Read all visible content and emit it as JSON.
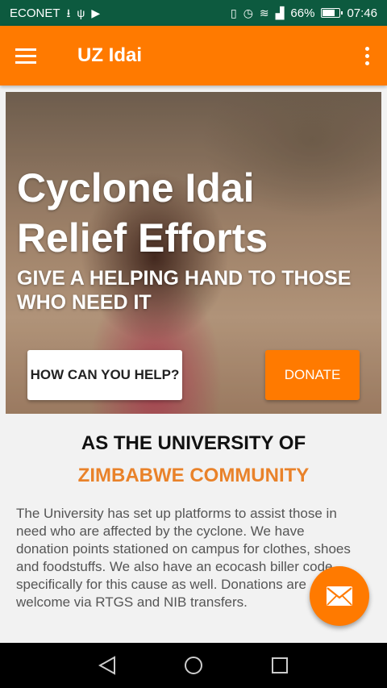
{
  "status_bar": {
    "carrier": "ECONET",
    "battery_percent": "66%",
    "battery_level": 0.66,
    "time": "07:46",
    "left_icons": [
      "download-icon",
      "usb-icon",
      "media-icon"
    ],
    "right_icons": [
      "vibrate-icon",
      "alarm-icon",
      "wifi-icon",
      "signal-icon",
      "battery-icon"
    ]
  },
  "app_bar": {
    "title": "UZ Idai",
    "menu_icon": "hamburger-menu-icon",
    "overflow_icon": "more-vertical-icon",
    "color": "#ff7a00"
  },
  "hero": {
    "title": "Cyclone Idai Relief Efforts",
    "subtitle": "GIVE A HELPING HAND TO THOSE WHO NEED IT",
    "help_button": "HOW CAN YOU HELP?",
    "donate_button": "DONATE"
  },
  "content": {
    "heading_line1": "AS THE UNIVERSITY OF",
    "heading_line2": "ZIMBABWE COMMUNITY",
    "heading2_color": "#e9822a",
    "body": " The University has set up platforms to assist those in need who are affected by the cyclone. We have donation points stationed on campus for clothes, shoes and foodstuffs.  We also have an ecocash biller code specifically for this cause as well. Donations are welcome via RTGS and NIB transfers."
  },
  "fab": {
    "icon": "mail-icon"
  },
  "nav_bar": {
    "icons": [
      "back-icon",
      "home-icon",
      "recents-icon"
    ]
  }
}
